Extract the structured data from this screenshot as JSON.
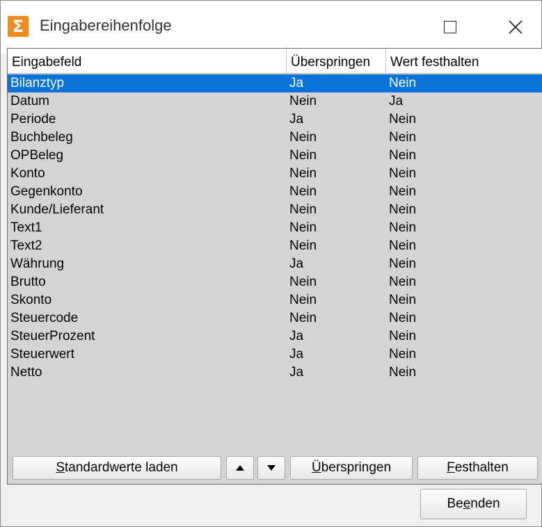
{
  "window": {
    "title": "Eingabereihenfolge",
    "app_icon_glyph": "Σ",
    "accent_color": "#0a73d9",
    "icon_color": "#f08a1c"
  },
  "grid": {
    "columns": [
      "Eingabefeld",
      "Überspringen",
      "Wert festhalten"
    ],
    "rows": [
      {
        "field": "Bilanztyp",
        "skip": "Ja",
        "hold": "Nein",
        "selected": true
      },
      {
        "field": "Datum",
        "skip": "Nein",
        "hold": "Ja"
      },
      {
        "field": "Periode",
        "skip": "Ja",
        "hold": "Nein"
      },
      {
        "field": "Buchbeleg",
        "skip": "Nein",
        "hold": "Nein"
      },
      {
        "field": "OPBeleg",
        "skip": "Nein",
        "hold": "Nein"
      },
      {
        "field": "Konto",
        "skip": "Nein",
        "hold": "Nein"
      },
      {
        "field": "Gegenkonto",
        "skip": "Nein",
        "hold": "Nein"
      },
      {
        "field": "Kunde/Lieferant",
        "skip": "Nein",
        "hold": "Nein"
      },
      {
        "field": "Text1",
        "skip": "Nein",
        "hold": "Nein"
      },
      {
        "field": "Text2",
        "skip": "Nein",
        "hold": "Nein"
      },
      {
        "field": "Währung",
        "skip": "Ja",
        "hold": "Nein"
      },
      {
        "field": "Brutto",
        "skip": "Nein",
        "hold": "Nein"
      },
      {
        "field": "Skonto",
        "skip": "Nein",
        "hold": "Nein"
      },
      {
        "field": "Steuercode",
        "skip": "Nein",
        "hold": "Nein"
      },
      {
        "field": "SteuerProzent",
        "skip": "Ja",
        "hold": "Nein"
      },
      {
        "field": "Steuerwert",
        "skip": "Ja",
        "hold": "Nein"
      },
      {
        "field": "Netto",
        "skip": "Ja",
        "hold": "Nein"
      }
    ]
  },
  "toolbar": {
    "load_defaults_prefix": "S",
    "load_defaults_rest": "tandardwerte laden",
    "skip_prefix": "Ü",
    "skip_rest": "berspringen",
    "hold_prefix": "F",
    "hold_rest": "esthalten",
    "up_icon": "triangle-up",
    "down_icon": "triangle-down"
  },
  "footer": {
    "end_prefix": "Be",
    "end_mnemonic": "e",
    "end_rest": "nden"
  }
}
